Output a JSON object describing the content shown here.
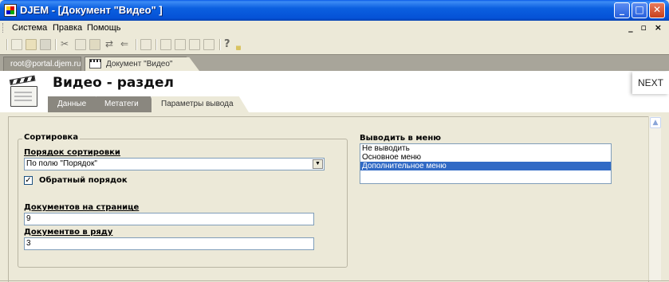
{
  "window": {
    "title": "DJEM - [Документ \"Видео\" ]",
    "controls": {
      "minimize": "_",
      "maximize": "□",
      "close": "✕"
    }
  },
  "menubar": {
    "items": [
      "Система",
      "Правка",
      "Помощь"
    ],
    "mdi_controls": "_ ▫ ×"
  },
  "toolbar": {
    "icons": [
      "new-icon",
      "open-icon",
      "save-icon",
      "cut-icon",
      "copy-icon",
      "paste-icon",
      "refresh-icon",
      "back-icon",
      "document-icon",
      "edit-icon",
      "list-icon",
      "forward-icon",
      "page-icon",
      "help-icon",
      "dropdown-icon"
    ]
  },
  "doc_tabs": [
    {
      "label": "root@portal.djem.ru",
      "active": false
    },
    {
      "label": "Документ \"Видео\"",
      "active": true
    }
  ],
  "header": {
    "title": "Видео - раздел",
    "next_label": "NEXT",
    "tabs": [
      {
        "label": "Данные",
        "active": false
      },
      {
        "label": "Метатеги",
        "active": false
      },
      {
        "label": "Параметры вывода",
        "active": true
      }
    ]
  },
  "sort_group": {
    "legend": "Сортировка",
    "order_label": "Порядок сортировки",
    "order_value": "По полю \"Порядок\"",
    "reverse_label": "Обратный порядок",
    "reverse_checked": true,
    "per_page_label": "Документов на странице",
    "per_page_value": "9",
    "per_row_label": "Документво в ряду",
    "per_row_value": "3"
  },
  "menu_output": {
    "label": "Выводить в меню",
    "options": [
      "Не выводить",
      "Основное меню",
      "Дополнительное меню"
    ],
    "selected_index": 2
  },
  "colors": {
    "titlebar": "#0b5fe0",
    "selection": "#316ac5",
    "window_bg": "#ece9d8"
  }
}
